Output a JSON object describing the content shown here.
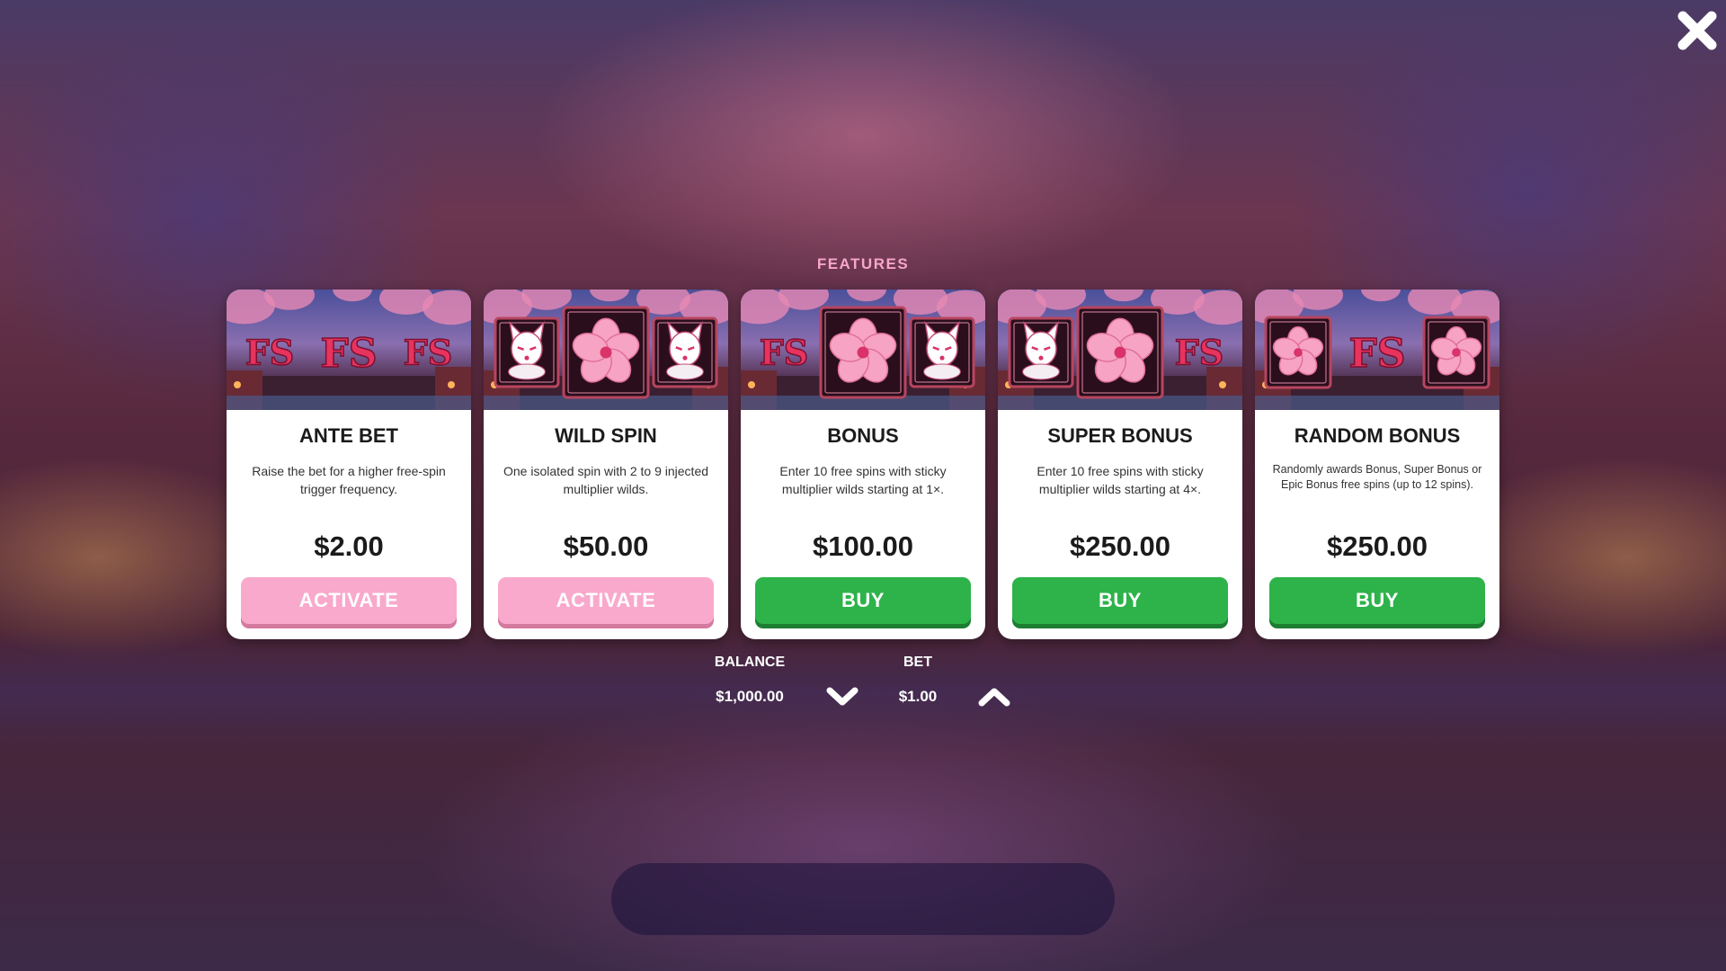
{
  "header": {
    "title": "FEATURES"
  },
  "close": {
    "icon": "close-icon"
  },
  "cards": [
    {
      "image_symbols": [
        "FS",
        "FS",
        "FS"
      ],
      "title": "ANTE BET",
      "description": "Raise the bet for a higher free-spin trigger frequency.",
      "price": "$2.00",
      "button_label": "ACTIVATE",
      "button_style": "pink"
    },
    {
      "image_symbols": [
        "fox-mask-icon",
        "cherry-blossom-icon",
        "fox-mask-icon"
      ],
      "title": "WILD SPIN",
      "description": "One isolated spin with 2 to 9 injected multiplier wilds.",
      "price": "$50.00",
      "button_label": "ACTIVATE",
      "button_style": "pink"
    },
    {
      "image_symbols": [
        "FS",
        "cherry-blossom-icon",
        "fox-mask-icon"
      ],
      "title": "BONUS",
      "description": "Enter 10 free spins with sticky multiplier wilds starting at 1×.",
      "price": "$100.00",
      "button_label": "BUY",
      "button_style": "green"
    },
    {
      "image_symbols": [
        "fox-mask-icon",
        "cherry-blossom-icon",
        "FS"
      ],
      "title": "SUPER BONUS",
      "description": "Enter 10 free spins with sticky multiplier wilds starting at 4×.",
      "price": "$250.00",
      "button_label": "BUY",
      "button_style": "green"
    },
    {
      "image_symbols": [
        "cherry-blossom-icon",
        "FS",
        "cherry-blossom-icon"
      ],
      "title": "RANDOM BONUS",
      "description": "Randomly awards Bonus, Super Bonus or Epic Bonus free spins (up to 12 spins).",
      "price": "$250.00",
      "button_label": "BUY",
      "button_style": "green"
    }
  ],
  "footer": {
    "balance_label": "BALANCE",
    "balance_value": "$1,000.00",
    "bet_label": "BET",
    "bet_value": "$1.00",
    "bet_decrease_icon": "chevron-down-icon",
    "bet_increase_icon": "chevron-up-icon"
  },
  "colors": {
    "title": "#f7a6c8",
    "activate_button": "#f9a9cc",
    "buy_button": "#2db34a",
    "fs_text": "#e8335f"
  }
}
